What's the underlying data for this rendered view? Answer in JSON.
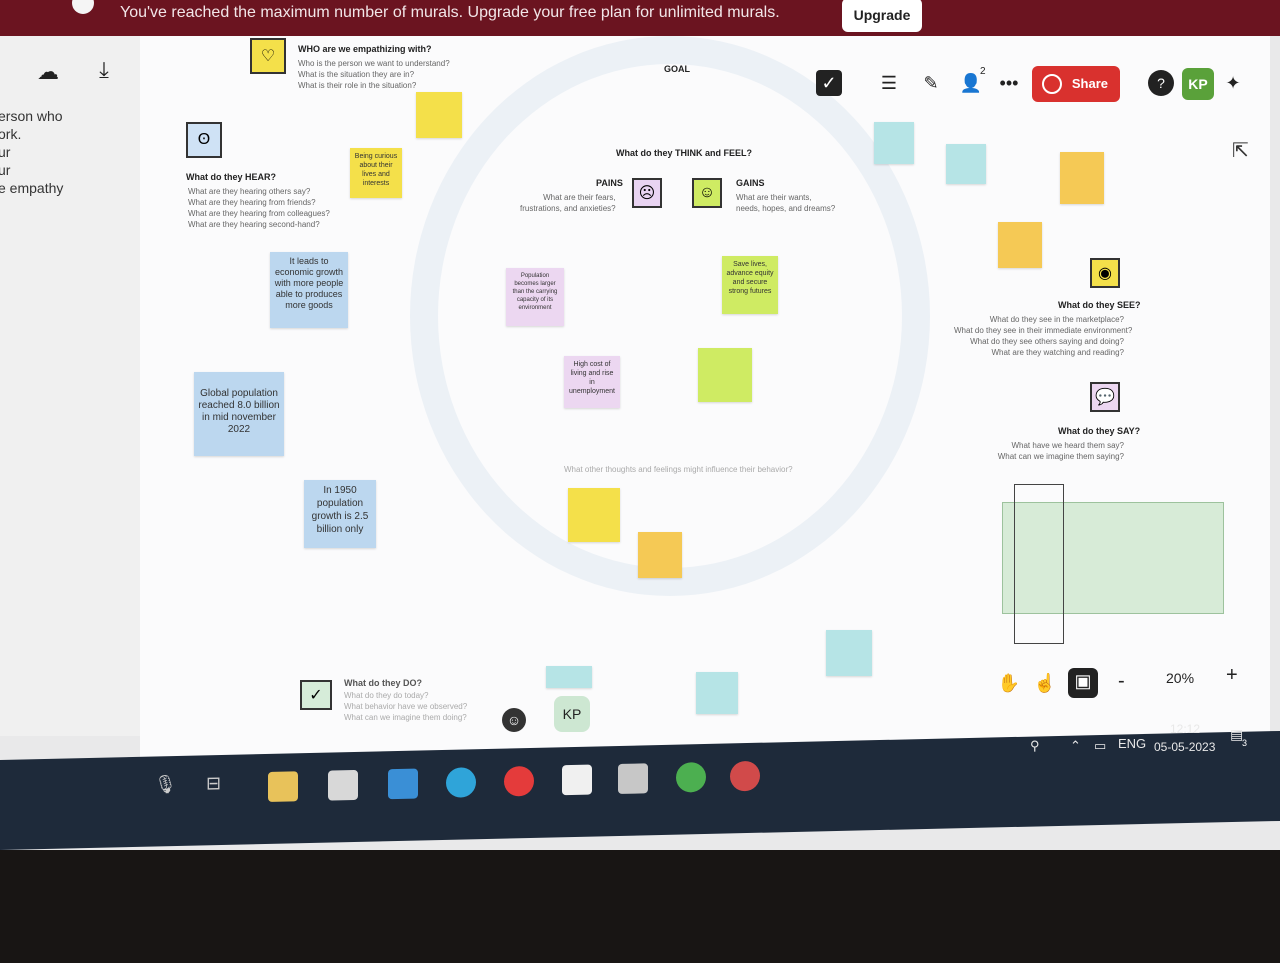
{
  "banner": {
    "text": "You've reached the maximum number of murals. Upgrade your free plan for unlimited murals.",
    "upgrade_label": "Upgrade"
  },
  "left_panel": {
    "lines": [
      "erson who",
      "ork.",
      "ur",
      "ur",
      "e empathy"
    ]
  },
  "toolbar": {
    "icons": [
      "cloud-check-icon",
      "download-icon",
      "search-icon"
    ]
  },
  "top_right": {
    "share_label": "Share",
    "user_count": "2",
    "avatar_initials": "KP"
  },
  "canvas": {
    "goal_label": "GOAL",
    "who": {
      "title": "WHO are we empathizing with?",
      "lines": [
        "Who is the person we want to understand?",
        "What is the situation they are in?",
        "What is their role in the situation?"
      ]
    },
    "think_feel_title": "What do they THINK and FEEL?",
    "pains": {
      "title": "PAINS",
      "lines": [
        "What are their fears,",
        "frustrations, and anxieties?"
      ]
    },
    "gains": {
      "title": "GAINS",
      "lines": [
        "What are their wants,",
        "needs, hopes, and dreams?"
      ]
    },
    "hear": {
      "title": "What do they HEAR?",
      "lines": [
        "What are they hearing others say?",
        "What are they hearing from friends?",
        "What are they hearing from colleagues?",
        "What are they hearing second-hand?"
      ]
    },
    "see": {
      "title": "What do they SEE?",
      "lines": [
        "What do they see in the marketplace?",
        "What do they see in their immediate environment?",
        "What do they see others saying and doing?",
        "What are they watching and reading?"
      ]
    },
    "say": {
      "title": "What do they SAY?",
      "lines": [
        "What have we heard them say?",
        "What can we imagine them saying?"
      ]
    },
    "do": {
      "title": "What do they DO?",
      "lines": [
        "What do they do today?",
        "What behavior have we observed?",
        "What can we imagine them doing?"
      ]
    },
    "other": "What other thoughts and feelings might influence their behavior?",
    "stickies": {
      "s1": "It leads to economic growth with more people able to produces more goods",
      "s2": "Global population reached 8.0 billion in mid november 2022",
      "s3": "In 1950 population growth is 2.5 billion only",
      "s4": "Being curious about their lives and interests",
      "s5": "Population becomes larger than the carrying capacity of its environment",
      "s6": "Save lives, advance equity and secure strong futures",
      "s7": "High cost of living and rise in unemployment"
    }
  },
  "bottom_bar": {
    "zoom": "20%",
    "minus": "-",
    "plus": "+",
    "avatar_initials": "KP"
  },
  "system_tray": {
    "lang": "ENG",
    "time": "12:12",
    "date": "05-05-2023",
    "notif_count": "3"
  }
}
